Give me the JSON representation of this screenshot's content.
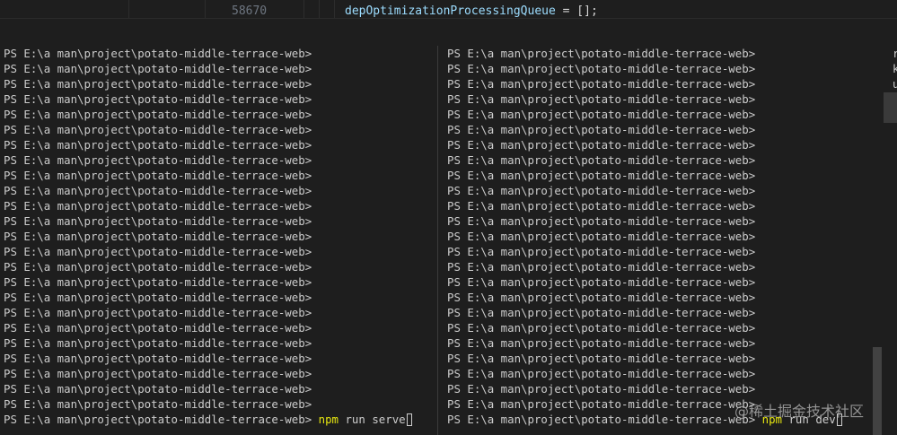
{
  "editor": {
    "line_number": "58670",
    "code_var": "depOptimizationProcessingQueue",
    "code_rest": " = [];"
  },
  "terminal": {
    "prompt": "PS E:\\a man\\project\\potato-middle-terrace-web>",
    "left_pane": {
      "empty_prompt_lines": 24,
      "command_name": "npm",
      "command_args": " run serve"
    },
    "right_pane": {
      "empty_prompt_lines": 24,
      "command_name": "npm",
      "command_args": " run dev"
    },
    "side_chars": [
      "r",
      "k",
      "u"
    ]
  },
  "watermark": "@稀土掘金技术社区",
  "colors": {
    "background": "#1e1e1e",
    "text": "#cccccc",
    "command_yellow": "#e5e510",
    "variable_blue": "#9cdcfe"
  }
}
